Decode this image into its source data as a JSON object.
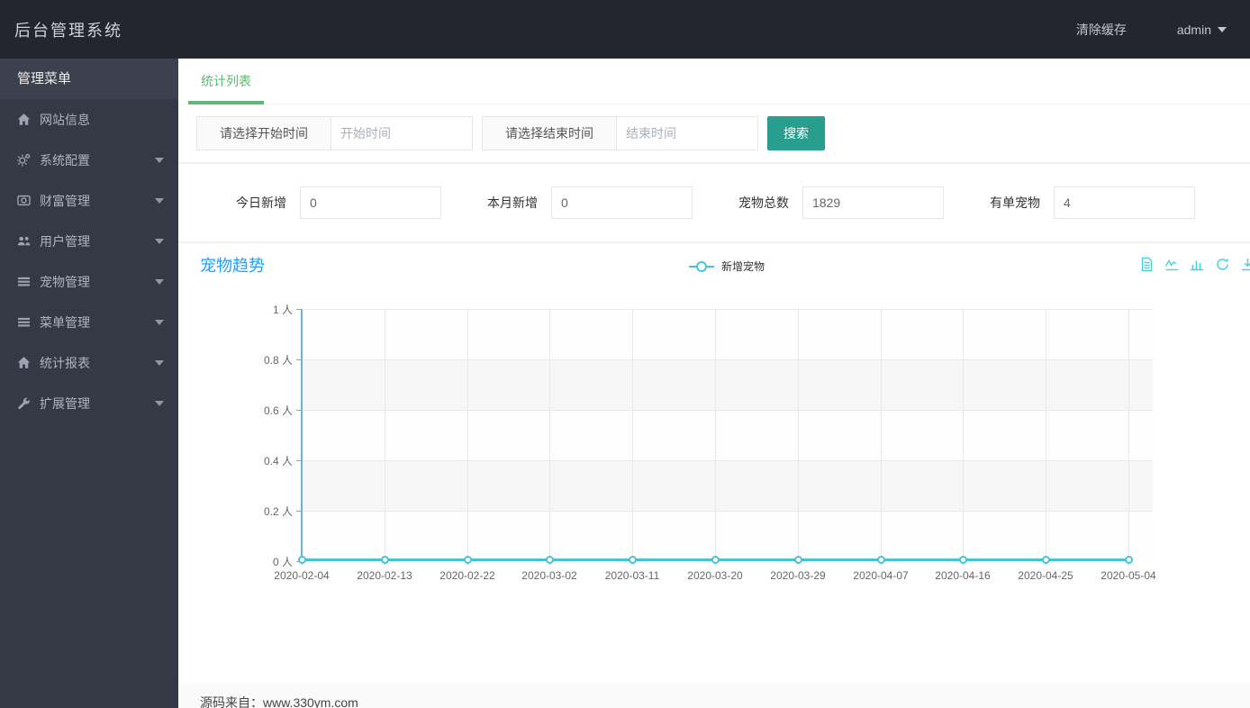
{
  "header": {
    "title": "后台管理系统",
    "clear_cache_label": "清除缓存",
    "user_name": "admin"
  },
  "sidebar": {
    "menu_title": "管理菜单",
    "items": [
      {
        "label": "网站信息",
        "icon": "home-icon",
        "has_children": false
      },
      {
        "label": "系统配置",
        "icon": "gears-icon",
        "has_children": true
      },
      {
        "label": "财富管理",
        "icon": "money-icon",
        "has_children": true
      },
      {
        "label": "用户管理",
        "icon": "users-icon",
        "has_children": true
      },
      {
        "label": "宠物管理",
        "icon": "list-icon",
        "has_children": true
      },
      {
        "label": "菜单管理",
        "icon": "list-icon",
        "has_children": true
      },
      {
        "label": "统计报表",
        "icon": "home-icon",
        "has_children": true
      },
      {
        "label": "扩展管理",
        "icon": "wrench-icon",
        "has_children": true
      }
    ]
  },
  "tabs": [
    {
      "label": "统计列表",
      "active": true
    }
  ],
  "filter": {
    "start_addon": "请选择开始时间",
    "start_placeholder": "开始时间",
    "start_value": "",
    "end_addon": "请选择结束时间",
    "end_placeholder": "结束时间",
    "end_value": "",
    "search_label": "搜索"
  },
  "stats": [
    {
      "label": "今日新增",
      "value": "0"
    },
    {
      "label": "本月新增",
      "value": "0"
    },
    {
      "label": "宠物总数",
      "value": "1829"
    },
    {
      "label": "有单宠物",
      "value": "4"
    }
  ],
  "chart_data": {
    "type": "line",
    "title": "宠物趋势",
    "categories": [
      "2020-02-04",
      "2020-02-13",
      "2020-02-22",
      "2020-03-02",
      "2020-03-11",
      "2020-03-20",
      "2020-03-29",
      "2020-04-07",
      "2020-04-16",
      "2020-04-25",
      "2020-05-04"
    ],
    "series": [
      {
        "name": "新增宠物",
        "values": [
          0,
          0,
          0,
          0,
          0,
          0,
          0,
          0,
          0,
          0,
          0
        ],
        "color": "#49c3d3"
      }
    ],
    "xlabel": "",
    "ylabel": "人",
    "ylim": [
      0,
      1
    ],
    "y_tick_labels": [
      "1 人",
      "0.8 人",
      "0.6 人",
      "0.4 人",
      "0.2 人",
      "0 人"
    ],
    "grid": true,
    "split_area": true,
    "legend_position": "top-center",
    "toolbox_icons": [
      "data-view-icon",
      "line-chart-icon",
      "bar-chart-icon",
      "refresh-icon",
      "download-icon"
    ]
  },
  "footer": {
    "text": "源码来自：www.330ym.com"
  },
  "colors": {
    "header_bg": "#23262e",
    "sidebar_bg": "#353946",
    "accent_green": "#5FB878",
    "button_teal": "#279e8e",
    "title_blue": "#1E9FFF",
    "series_teal": "#49c3d3",
    "axis_blue": "#6cb2e3",
    "toolbox_cyan": "#4fd0dc"
  }
}
